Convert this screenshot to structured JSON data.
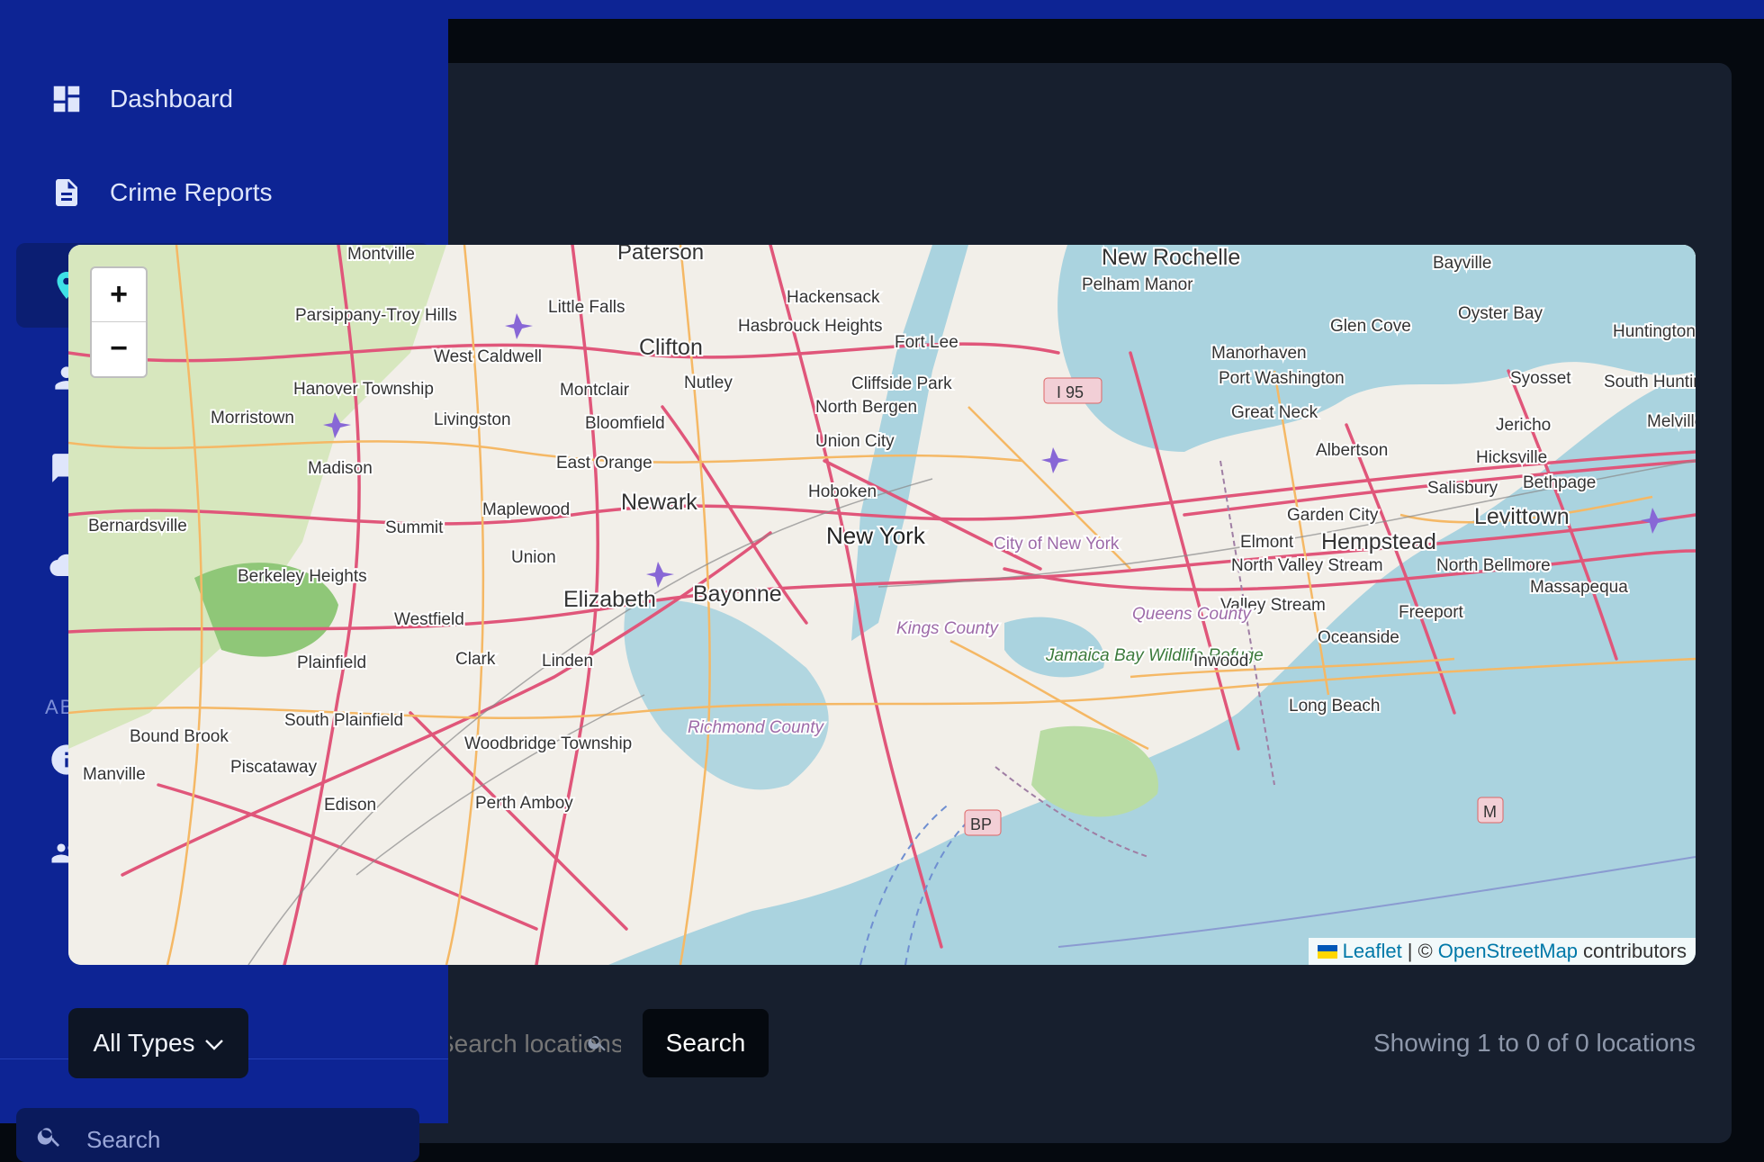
{
  "sidebar": {
    "items": [
      {
        "label": "Dashboard",
        "icon": "dashboard-icon"
      },
      {
        "label": "Crime Reports",
        "icon": "document-icon"
      },
      {
        "label": "",
        "icon": "map-pin-icon"
      },
      {
        "label": "",
        "icon": "person-icon"
      },
      {
        "label": "",
        "icon": "chat-icon"
      },
      {
        "label": "",
        "icon": "cloud-icon"
      },
      {
        "label": "",
        "icon": "info-icon"
      },
      {
        "label": "",
        "icon": "group-icon"
      }
    ],
    "section_label": "AB",
    "search_placeholder": "Search"
  },
  "map": {
    "zoom_in": "+",
    "zoom_out": "−",
    "attribution": {
      "leaflet": "Leaflet",
      "separator": "| ©",
      "osm": "OpenStreetMap",
      "suffix": "contributors"
    },
    "labels": [
      "Paterson",
      "New Rochelle",
      "Pelham Manor",
      "Bayville",
      "Montville",
      "Little Falls",
      "Hackensack",
      "Oyster Bay",
      "Glen Cove",
      "Huntington Station",
      "Parsippany-Troy Hills",
      "Clifton",
      "Hasbrouck Heights",
      "Fort Lee",
      "Manorhaven",
      "Port Washington",
      "Syosset",
      "South Huntington",
      "West Caldwell",
      "Nutley",
      "Montclair",
      "Cliffside Park",
      "Hanover Township",
      "Morristown",
      "Livingston",
      "Bloomfield",
      "North Bergen",
      "Great Neck",
      "Jericho",
      "Melville",
      "Union City",
      "Albertson",
      "Hicksville",
      "East Orange",
      "Madison",
      "Salisbury",
      "Bethpage",
      "Hoboken",
      "Newark",
      "Maplewood",
      "Garden City",
      "Levittown",
      "Bernardsville",
      "Summit",
      "New York",
      "City of New York",
      "Elmont",
      "Hempstead",
      "Union",
      "North Valley Stream",
      "North Bellmore",
      "Berkeley Heights",
      "Elizabeth",
      "Bayonne",
      "Massapequa",
      "Valley Stream",
      "Freeport",
      "Westfield",
      "Kings County",
      "Queens County",
      "Oceanside",
      "Plainfield",
      "Clark",
      "Linden",
      "Jamaica Bay Wildlife Refuge",
      "Inwood",
      "Long Beach",
      "South Plainfield",
      "Bound Brook",
      "Richmond County",
      "Woodbridge Township",
      "Manville",
      "Piscataway",
      "Edison",
      "Perth Amboy",
      "I 95",
      "BP",
      "M"
    ]
  },
  "filters": {
    "type_select": "All Types",
    "search_placeholder": "Search locations...",
    "search_button": "Search",
    "showing": "Showing 1 to 0 of 0 locations"
  }
}
